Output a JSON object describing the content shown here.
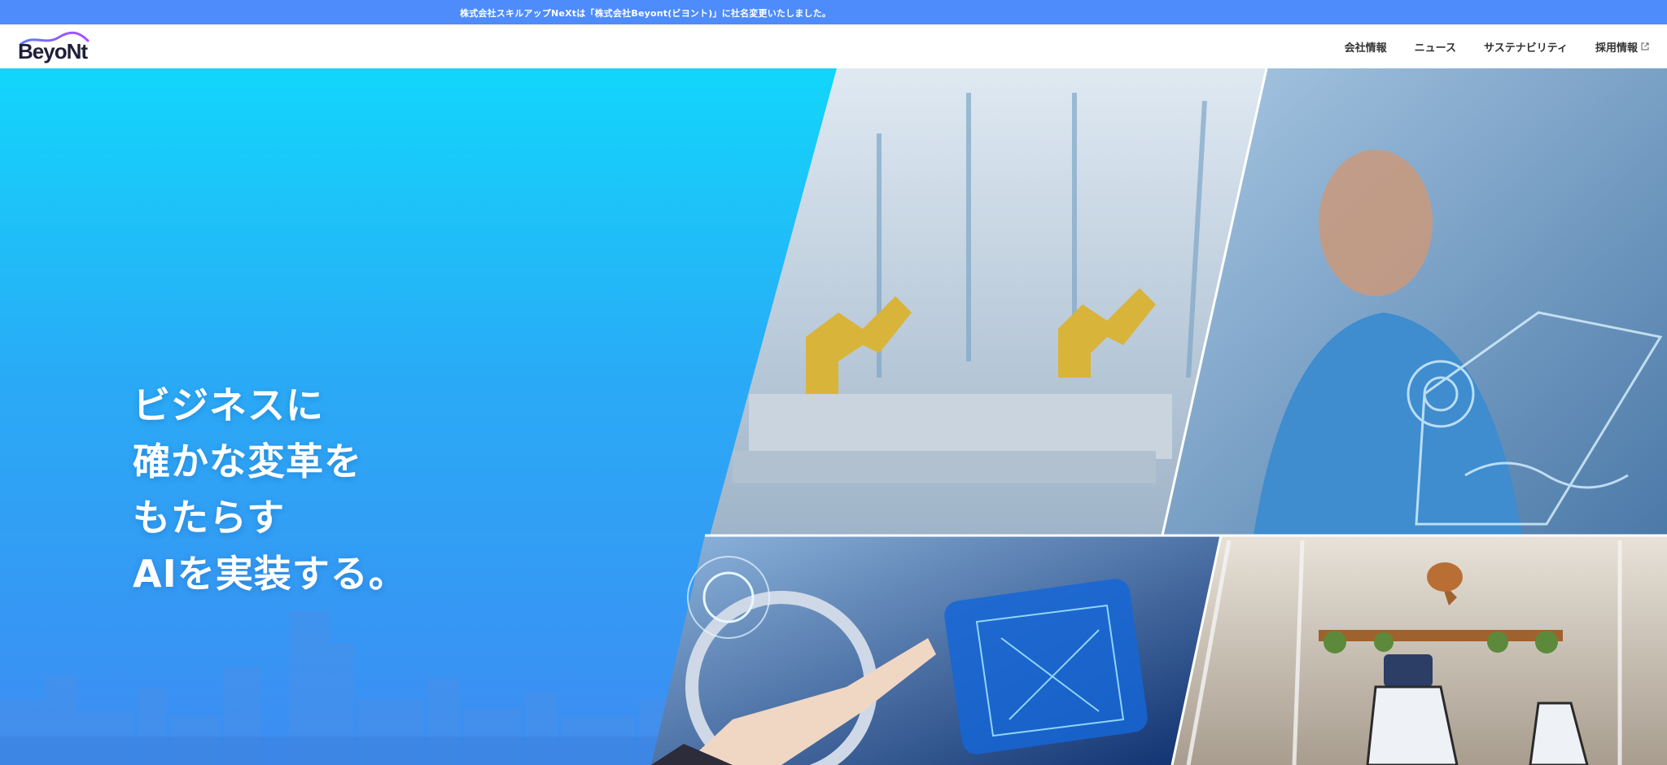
{
  "announcement": {
    "text": "株式会社スキルアップNeXtは「株式会社Beyont(ビヨント)」に社名変更いたしました。"
  },
  "logo": {
    "text": "BeyoNt"
  },
  "nav": {
    "items": [
      {
        "label": "会社情報"
      },
      {
        "label": "ニュース"
      },
      {
        "label": "サステナビリティ"
      },
      {
        "label": "採用情報"
      }
    ]
  },
  "hero": {
    "headline_lines": [
      "ビジネスに",
      "確かな変革を",
      "もたらす",
      "AIを実装する。"
    ]
  },
  "colors": {
    "announcement_bg": "#4e8bfb",
    "hero_top": "#12d6fb",
    "hero_bottom": "#3d8cf2"
  }
}
